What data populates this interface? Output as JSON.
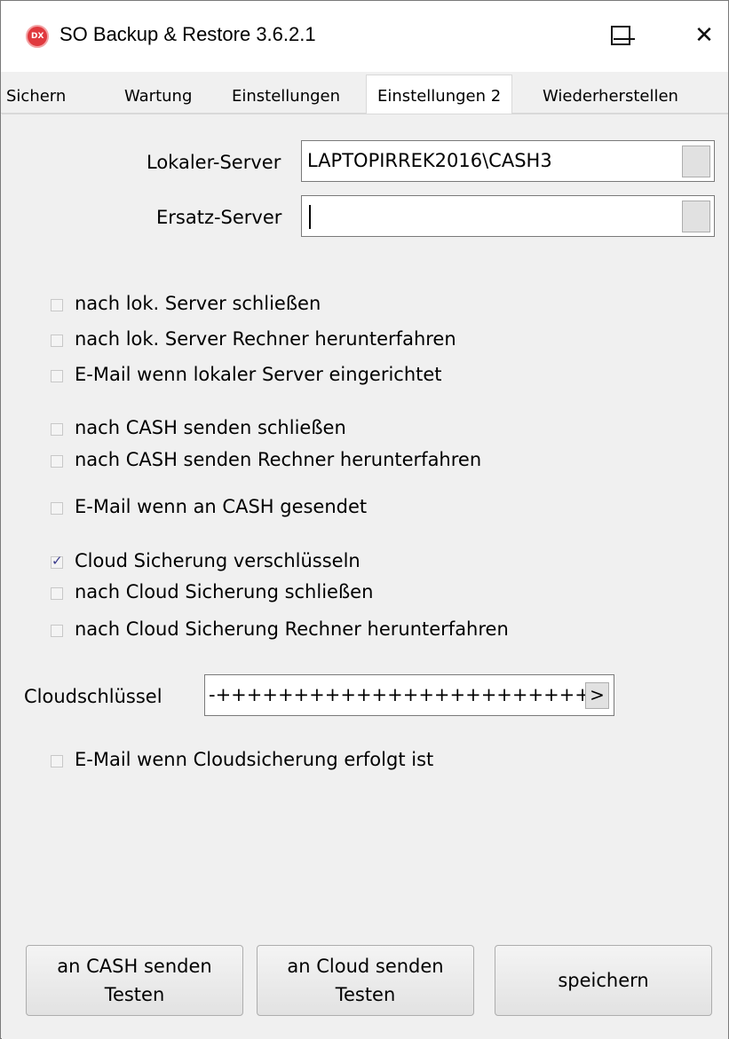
{
  "window": {
    "title": "SO Backup & Restore 3.6.2.1",
    "close_glyph": "✕"
  },
  "tabs": [
    {
      "label": "Sichern"
    },
    {
      "label": "Wartung"
    },
    {
      "label": "Einstellungen"
    },
    {
      "label": "Einstellungen 2",
      "active": true
    },
    {
      "label": "Wiederherstellen"
    }
  ],
  "server": {
    "local_label": "Lokaler-Server",
    "local_value": "LAPTOPIRREK2016\\CASH3",
    "replacement_label": "Ersatz-Server",
    "replacement_value": ""
  },
  "checkboxes": {
    "group_local": [
      {
        "label": "nach lok. Server schließen",
        "checked": false
      },
      {
        "label": "nach lok. Server Rechner herunterfahren",
        "checked": false
      },
      {
        "label": "E-Mail wenn lokaler Server eingerichtet",
        "checked": false
      }
    ],
    "group_cash": [
      {
        "label": "nach CASH senden schließen",
        "checked": false
      },
      {
        "label": "nach CASH senden Rechner herunterfahren",
        "checked": false
      },
      {
        "label": "E-Mail wenn an CASH gesendet",
        "checked": false
      }
    ],
    "group_cloud": [
      {
        "label": "Cloud Sicherung verschlüsseln",
        "checked": true
      },
      {
        "label": "nach Cloud Sicherung schließen",
        "checked": false
      },
      {
        "label": "nach Cloud Sicherung Rechner herunterfahren",
        "checked": false
      }
    ],
    "cloud_email": {
      "label": "E-Mail wenn Cloudsicherung erfolgt ist",
      "checked": false
    }
  },
  "cloud_key": {
    "label": "Cloudschlüssel",
    "value": "-+++++++++++++++++++++++++",
    "button_label": ">"
  },
  "buttons": {
    "cash_test": "an CASH senden\nTesten",
    "cloud_test": "an Cloud senden\nTesten",
    "save": "speichern"
  }
}
